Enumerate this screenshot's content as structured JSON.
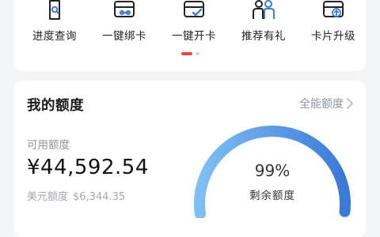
{
  "shortcuts": [
    {
      "label": "进度查询",
      "icon": "progress-search-icon"
    },
    {
      "label": "一键绑卡",
      "icon": "bind-card-icon"
    },
    {
      "label": "一键开卡",
      "icon": "activate-card-icon"
    },
    {
      "label": "推荐有礼",
      "icon": "referral-people-icon"
    },
    {
      "label": "卡片升级",
      "icon": "card-upgrade-icon"
    }
  ],
  "pager": {
    "current": 1,
    "total": 2
  },
  "quota": {
    "title": "我的额度",
    "all_quota_link": "全能额度",
    "available_label": "可用额度",
    "available_amount": "¥44,592.54",
    "usd_label": "美元额度",
    "usd_amount": "$6,344.35",
    "remaining_percent_text": "99%",
    "remaining_fraction": 0.99,
    "remaining_label": "剩余额度"
  },
  "colors": {
    "accent_red": "#e8453c",
    "icon_blue": "#3a7bd5",
    "gauge_start": "#7fc0f3",
    "gauge_end": "#3b79d9",
    "gauge_track": "#e8eef6"
  }
}
